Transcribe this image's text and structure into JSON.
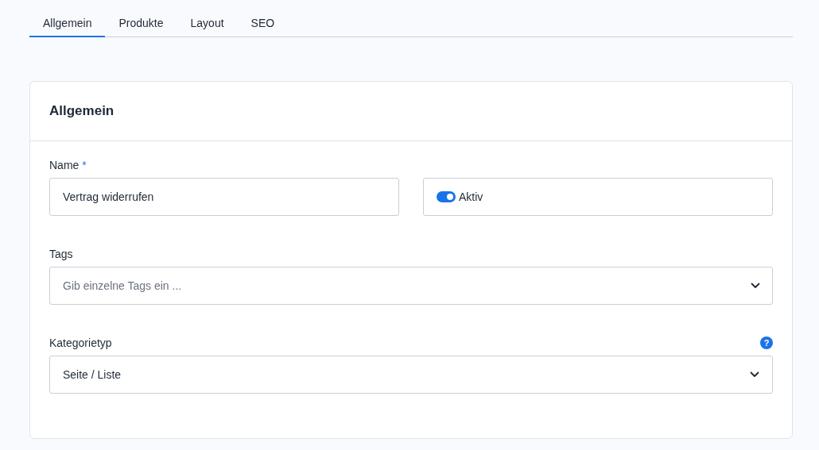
{
  "tabs": [
    {
      "label": "Allgemein",
      "selected": true
    },
    {
      "label": "Produkte",
      "selected": false
    },
    {
      "label": "Layout",
      "selected": false
    },
    {
      "label": "SEO",
      "selected": false
    }
  ],
  "card": {
    "title": "Allgemein",
    "name_field": {
      "label": "Name",
      "required_mark": "*",
      "value": "Vertrag widerrufen"
    },
    "active_toggle": {
      "label": "Aktiv",
      "on": true
    },
    "tags_field": {
      "label": "Tags",
      "placeholder": "Gib einzelne Tags ein ..."
    },
    "category_field": {
      "label": "Kategorietyp",
      "help": "?",
      "value": "Seite / Liste"
    }
  }
}
